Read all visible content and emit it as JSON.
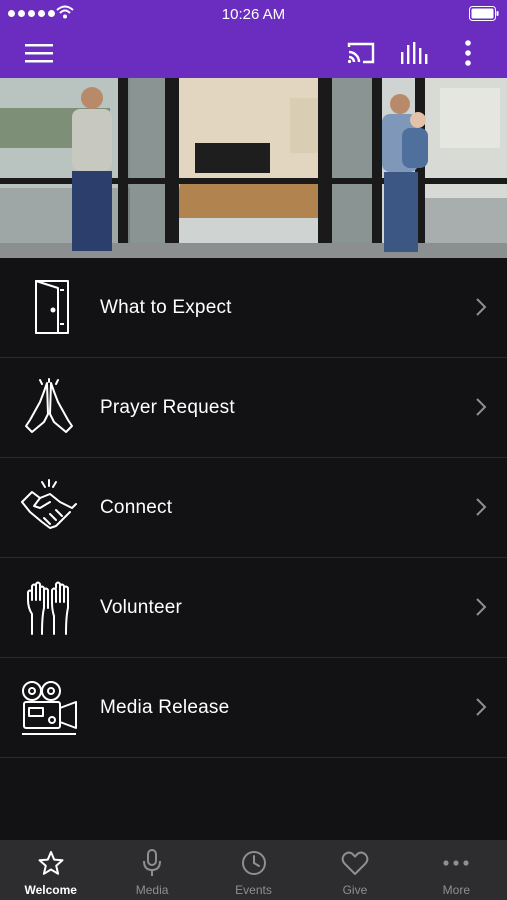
{
  "status_bar": {
    "time": "10:26 AM",
    "signal_icon": "signal-dots-icon",
    "wifi_icon": "wifi-icon",
    "battery_icon": "battery-icon"
  },
  "app_bar": {
    "menu_icon": "hamburger-menu-icon",
    "cast_icon": "cast-icon",
    "audio_icon": "equalizer-icon",
    "more_icon": "vertical-dots-icon",
    "background_color": "#6a2dc0"
  },
  "menu": {
    "items": [
      {
        "label": "What to Expect",
        "icon": "door-icon"
      },
      {
        "label": "Prayer Request",
        "icon": "praying-hands-icon"
      },
      {
        "label": "Connect",
        "icon": "handshake-icon"
      },
      {
        "label": "Volunteer",
        "icon": "raised-hands-icon"
      },
      {
        "label": "Media Release",
        "icon": "video-camera-icon"
      }
    ]
  },
  "tab_bar": {
    "tabs": [
      {
        "label": "Welcome",
        "icon": "star-icon",
        "active": true
      },
      {
        "label": "Media",
        "icon": "microphone-icon",
        "active": false
      },
      {
        "label": "Events",
        "icon": "clock-icon",
        "active": false
      },
      {
        "label": "Give",
        "icon": "heart-icon",
        "active": false
      },
      {
        "label": "More",
        "icon": "horizontal-dots-icon",
        "active": false
      }
    ]
  }
}
